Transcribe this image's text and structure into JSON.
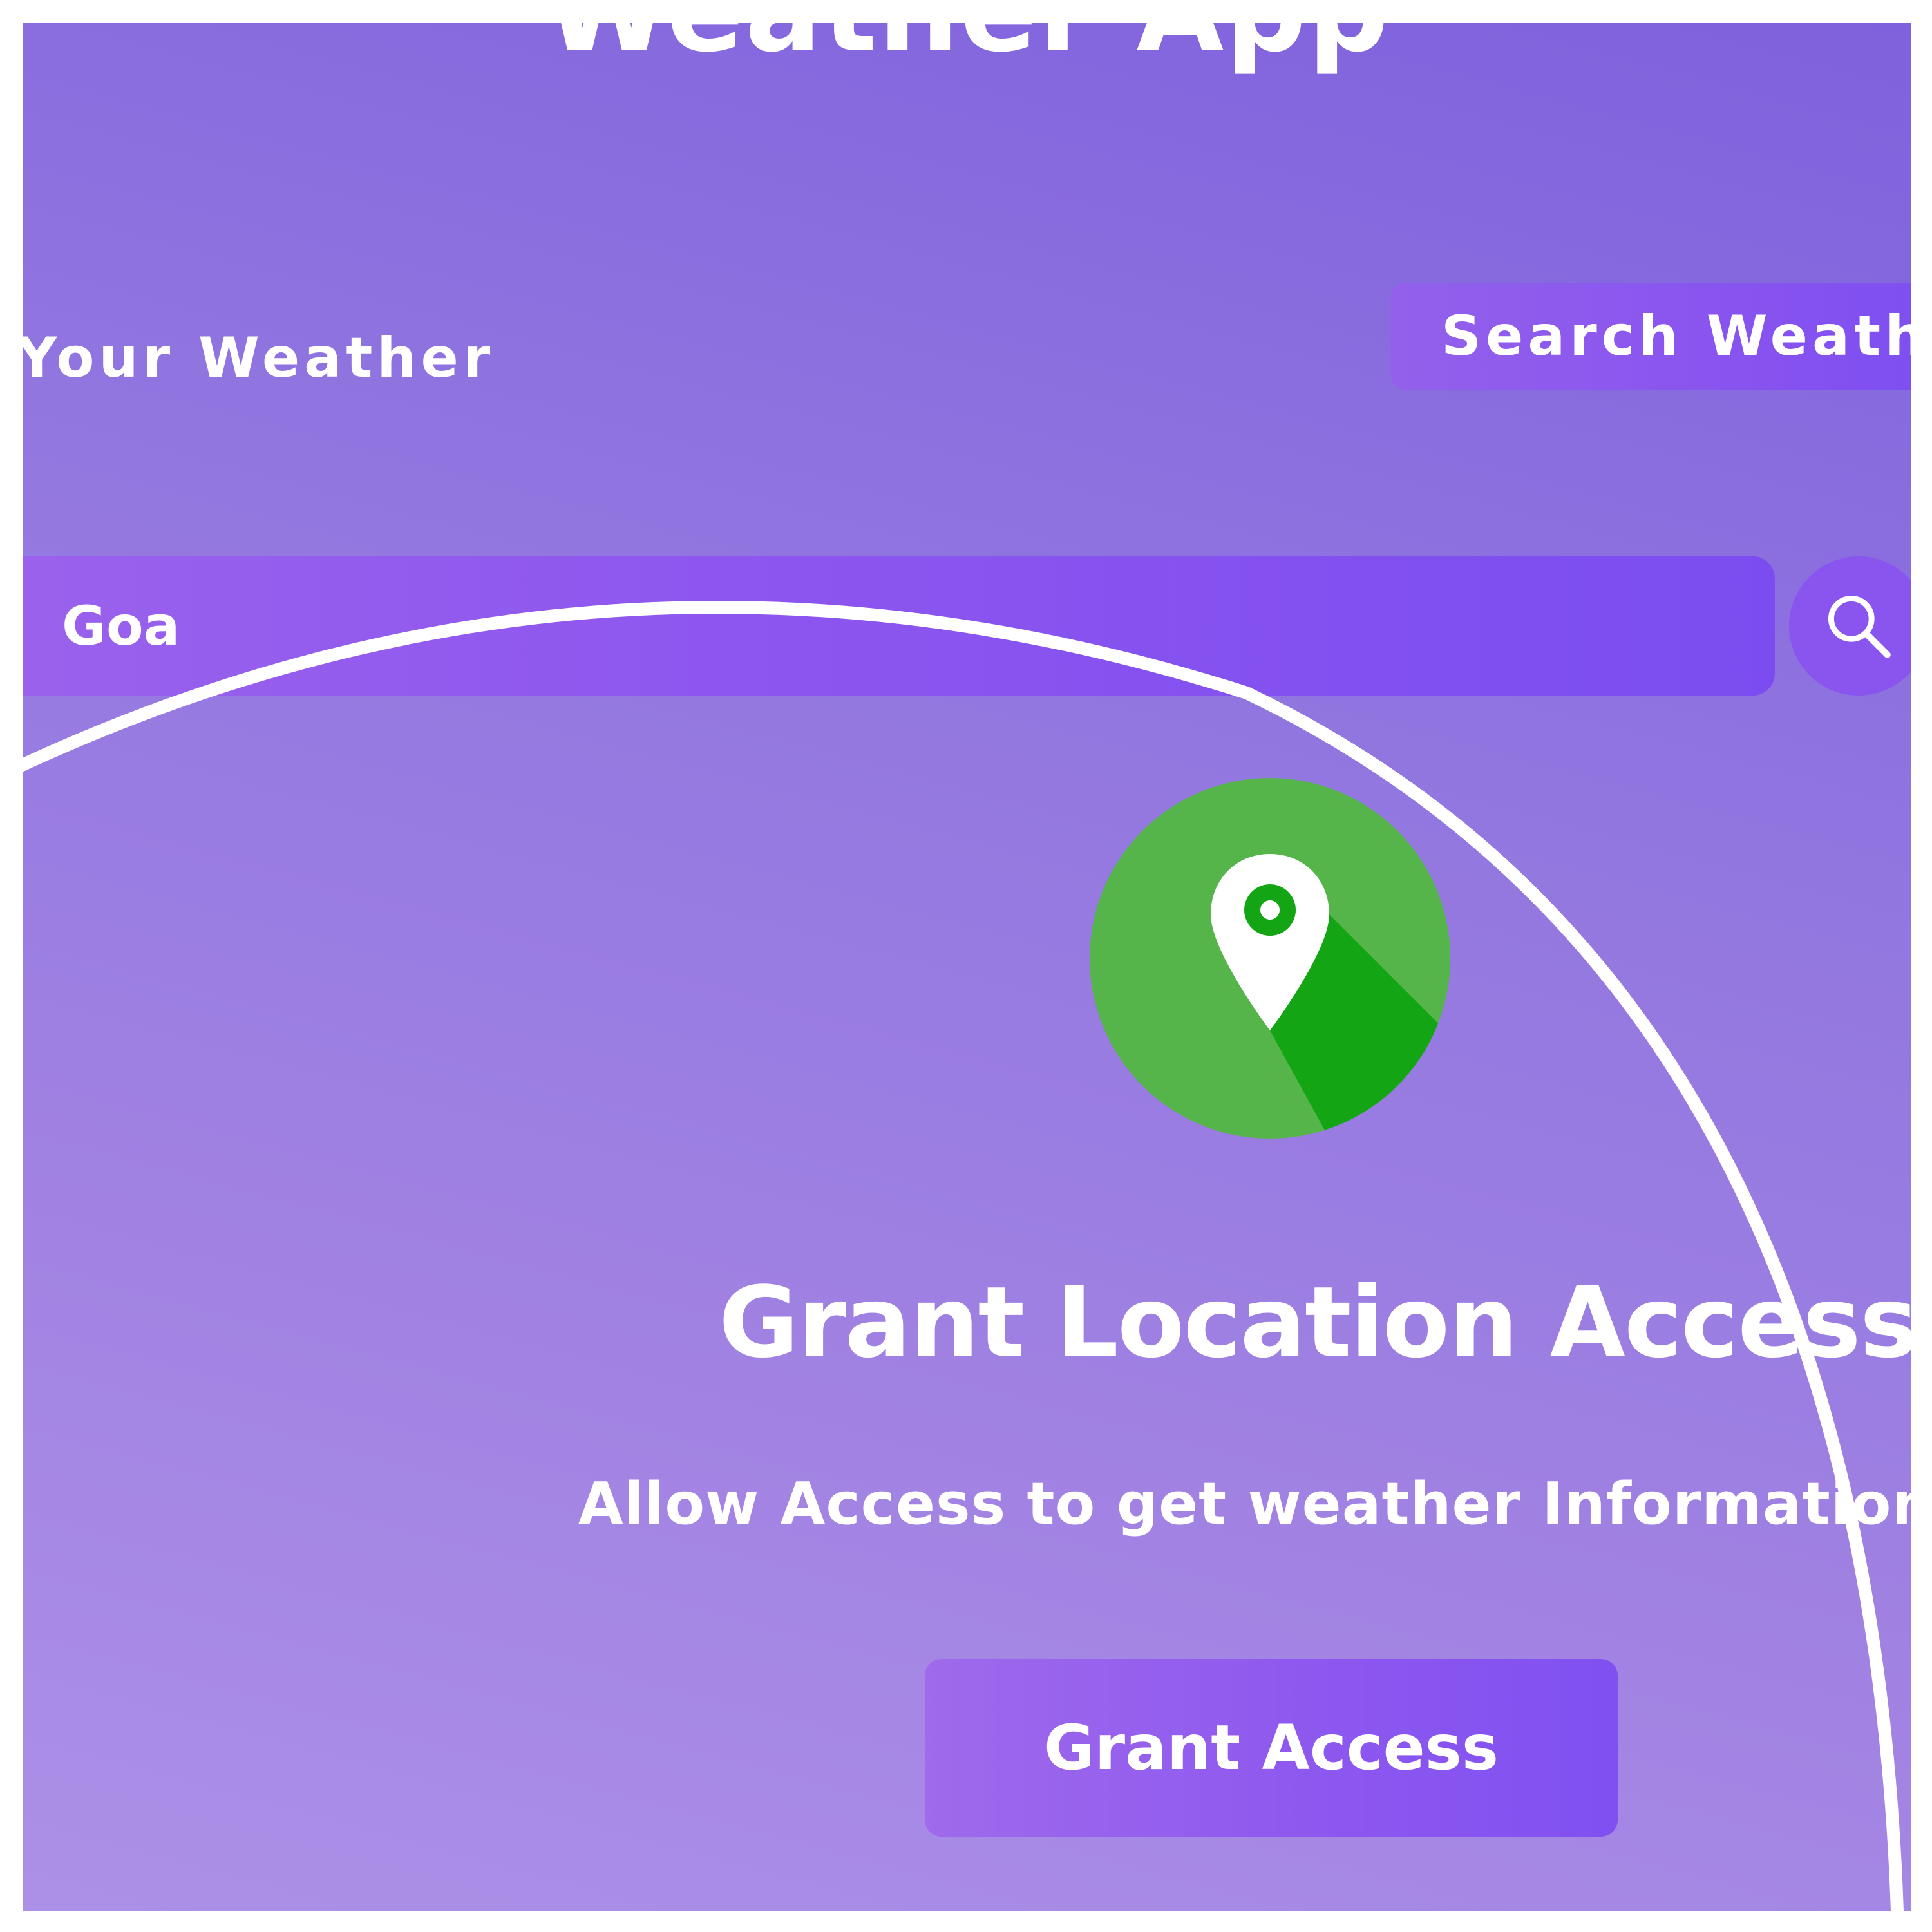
{
  "app": {
    "title": "Weather App"
  },
  "tabs": [
    {
      "label": "Your Weather",
      "active": false
    },
    {
      "label": "Search Weather",
      "active": true
    }
  ],
  "search": {
    "value": "Goa",
    "placeholder": "",
    "button_icon": "search-icon"
  },
  "grant_access": {
    "icon": "location-pin-icon",
    "heading": "Grant Location Access",
    "subtext": "Allow Access to get weather Information",
    "button_label": "Grant Access"
  },
  "colors": {
    "background_top": "#7f61dd",
    "background_bottom": "#ac90e7",
    "accent": "#8a55ef",
    "icon_green": "#55b54a",
    "icon_green_shadow": "#13a513",
    "text": "#ffffff"
  }
}
